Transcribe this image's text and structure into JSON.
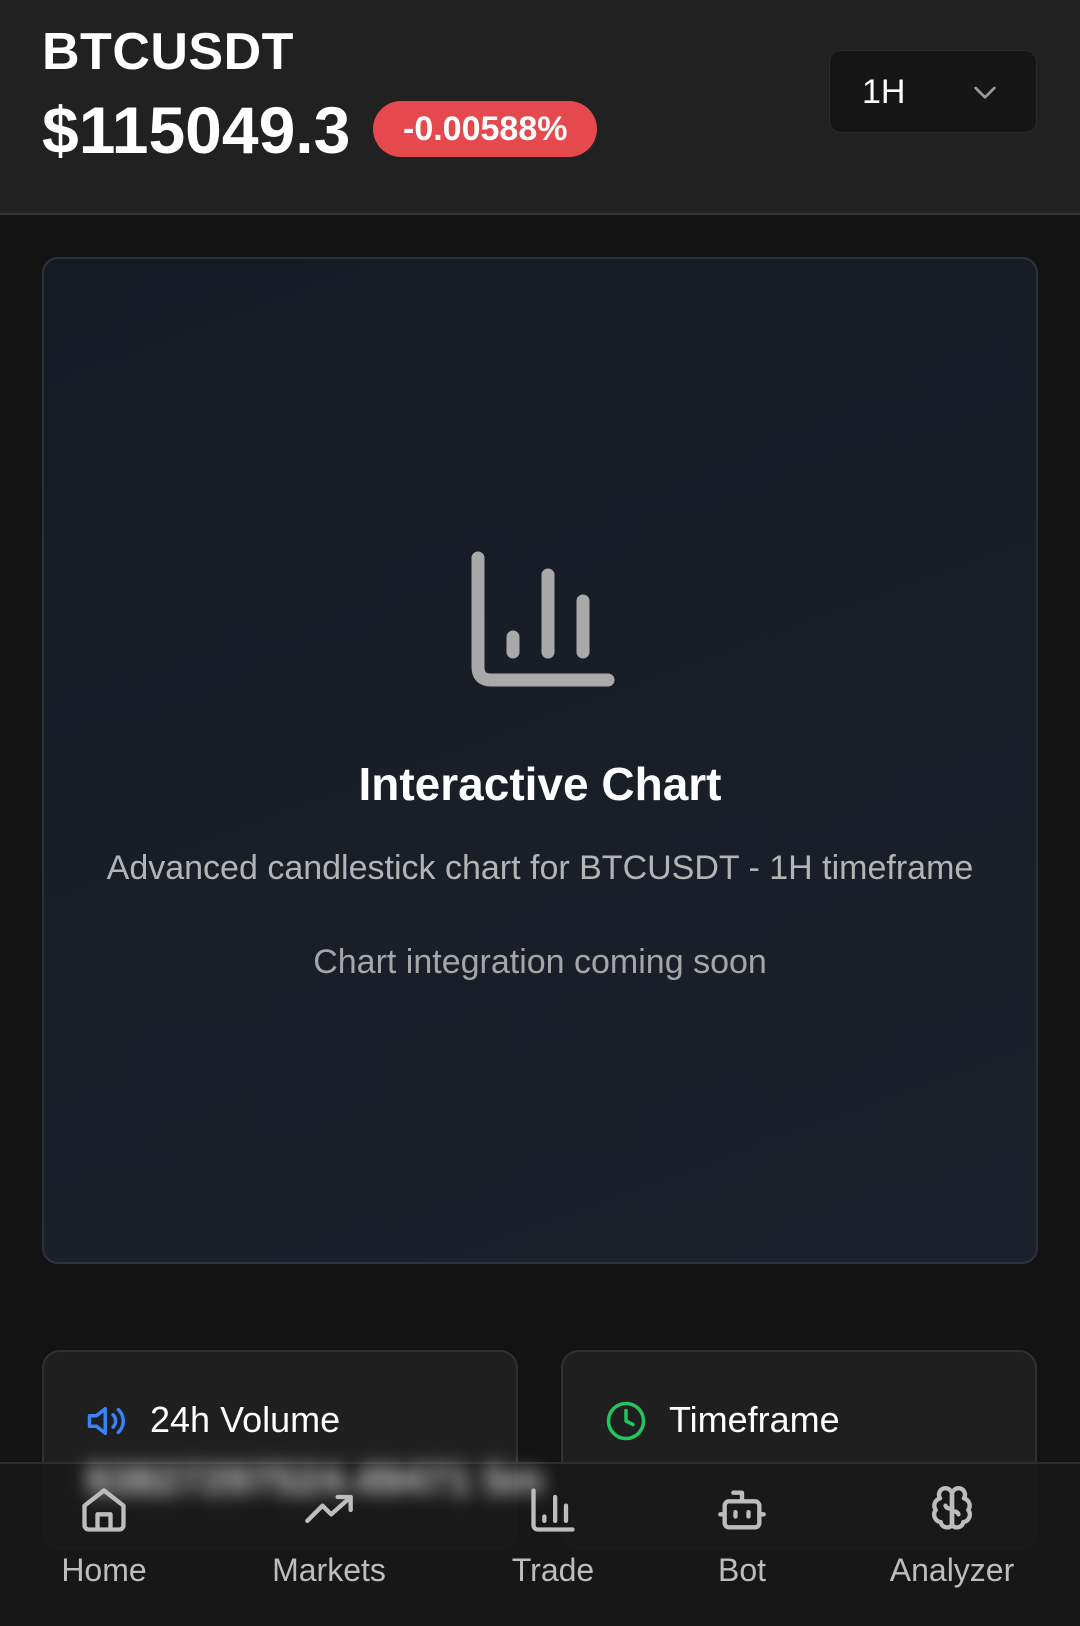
{
  "header": {
    "symbol": "BTCUSDT",
    "price": "$115049.3",
    "change": "-0.00588%",
    "change_color": "#e5484d",
    "timeframe": "1H"
  },
  "chart_placeholder": {
    "icon": "bar-chart-icon",
    "title": "Interactive Chart",
    "subtitle": "Advanced candlestick chart for BTCUSDT - 1H timeframe",
    "note": "Chart integration coming soon"
  },
  "stats": [
    {
      "icon": "volume-icon",
      "icon_color": "#3b82f6",
      "label": "24h Volume",
      "value": "$3827297524.49471  5m"
    },
    {
      "icon": "clock-icon",
      "icon_color": "#22c55e",
      "label": "Timeframe"
    }
  ],
  "nav": [
    {
      "icon": "home-icon",
      "label": "Home"
    },
    {
      "icon": "trending-up-icon",
      "label": "Markets"
    },
    {
      "icon": "bar-chart-icon",
      "label": "Trade"
    },
    {
      "icon": "bot-icon",
      "label": "Bot"
    },
    {
      "icon": "brain-icon",
      "label": "Analyzer"
    }
  ]
}
